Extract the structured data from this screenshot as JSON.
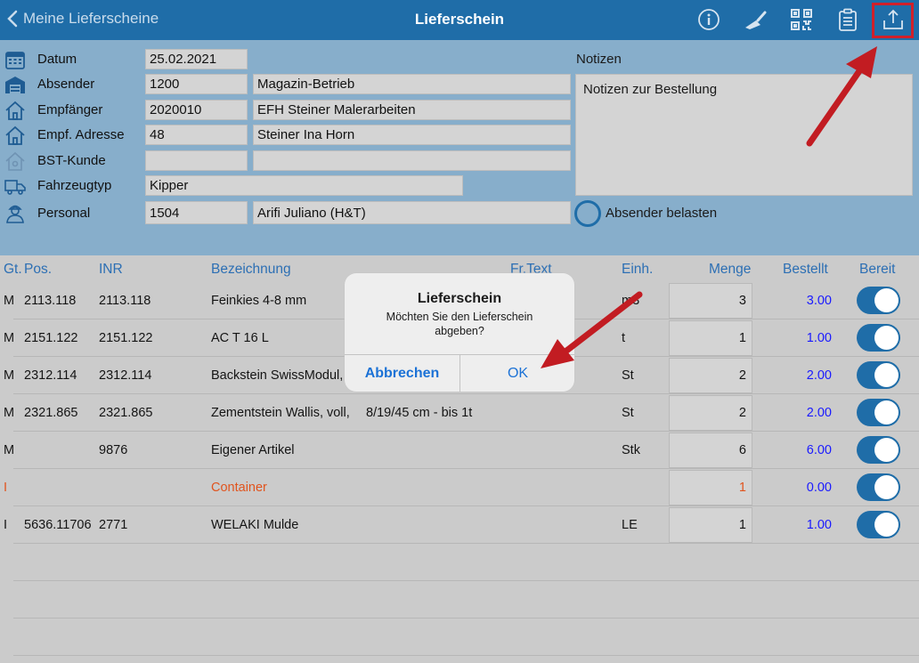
{
  "nav": {
    "back_label": "Meine Lieferscheine",
    "title": "Lieferschein",
    "icons": [
      "info-icon",
      "trowel-icon",
      "qr-code-icon",
      "clipboard-icon",
      "share-upload-icon"
    ]
  },
  "header": {
    "datum_label": "Datum",
    "datum_value": "25.02.2021",
    "absender_label": "Absender",
    "absender_code": "1200",
    "absender_name": "Magazin-Betrieb",
    "empfaenger_label": "Empfänger",
    "empfaenger_code": "2020010",
    "empfaenger_name": "EFH Steiner Malerarbeiten",
    "adresse_label": "Empf. Adresse",
    "adresse_code": "48",
    "adresse_name": "Steiner Ina Horn",
    "bst_label": "BST-Kunde",
    "bst_code": "",
    "bst_name": "",
    "fahrzeug_label": "Fahrzeugtyp",
    "fahrzeug_value": "Kipper",
    "personal_label": "Personal",
    "personal_code": "1504",
    "personal_name": "Arifi Juliano (H&T)",
    "notes_label": "Notizen",
    "notes_value": "Notizen zur Bestellung",
    "absender_belasten_label": "Absender belasten"
  },
  "table": {
    "columns": {
      "gt": "Gt.",
      "pos": "Pos.",
      "inr": "INR",
      "bez": "Bezeichnung",
      "frtext": "Fr.Text",
      "einh": "Einh.",
      "menge": "Menge",
      "bestellt": "Bestellt",
      "bereit": "Bereit"
    },
    "rows": [
      {
        "gt": "M",
        "pos": "2113.118",
        "inr": "2113.118",
        "bez": "Feinkies 4-8 mm",
        "frtext": "",
        "einh": "m3",
        "menge": "3",
        "bestellt": "3.00",
        "bereit": true
      },
      {
        "gt": "M",
        "pos": "2151.122",
        "inr": "2151.122",
        "bez": "AC T 16 L",
        "frtext": "",
        "einh": "t",
        "menge": "1",
        "bestellt": "1.00",
        "bereit": true
      },
      {
        "gt": "M",
        "pos": "2312.114",
        "inr": "2312.114",
        "bez": "Backstein SwissModul,",
        "frtext": "",
        "einh": "St",
        "menge": "2",
        "bestellt": "2.00",
        "bereit": true
      },
      {
        "gt": "M",
        "pos": "2321.865",
        "inr": "2321.865",
        "bez": "Zementstein Wallis, voll,",
        "frtext": "8/19/45 cm - bis 1t",
        "einh": "St",
        "menge": "2",
        "bestellt": "2.00",
        "bereit": true
      },
      {
        "gt": "M",
        "pos": "",
        "inr": "9876",
        "bez": "Eigener Artikel",
        "frtext": "",
        "einh": "Stk",
        "menge": "6",
        "bestellt": "6.00",
        "bereit": true
      },
      {
        "gt": "I",
        "pos": "",
        "inr": "",
        "bez": "Container",
        "frtext": "",
        "einh": "",
        "menge": "1",
        "bestellt": "0.00",
        "bereit": true
      },
      {
        "gt": "I",
        "pos": "5636.11706",
        "inr": "2771",
        "bez": "WELAKI Mulde",
        "frtext": "",
        "einh": "LE",
        "menge": "1",
        "bestellt": "1.00",
        "bereit": true
      }
    ]
  },
  "alert": {
    "title": "Lieferschein",
    "message": "Möchten Sie den Lieferschein abgeben?",
    "cancel_label": "Abbrechen",
    "ok_label": "OK"
  },
  "colors": {
    "navbar": "#1f6da8",
    "form_bg": "#87aecb",
    "link_blue": "#2c6fb4",
    "orange": "#e0541e",
    "annotation_red": "#d0202a"
  }
}
